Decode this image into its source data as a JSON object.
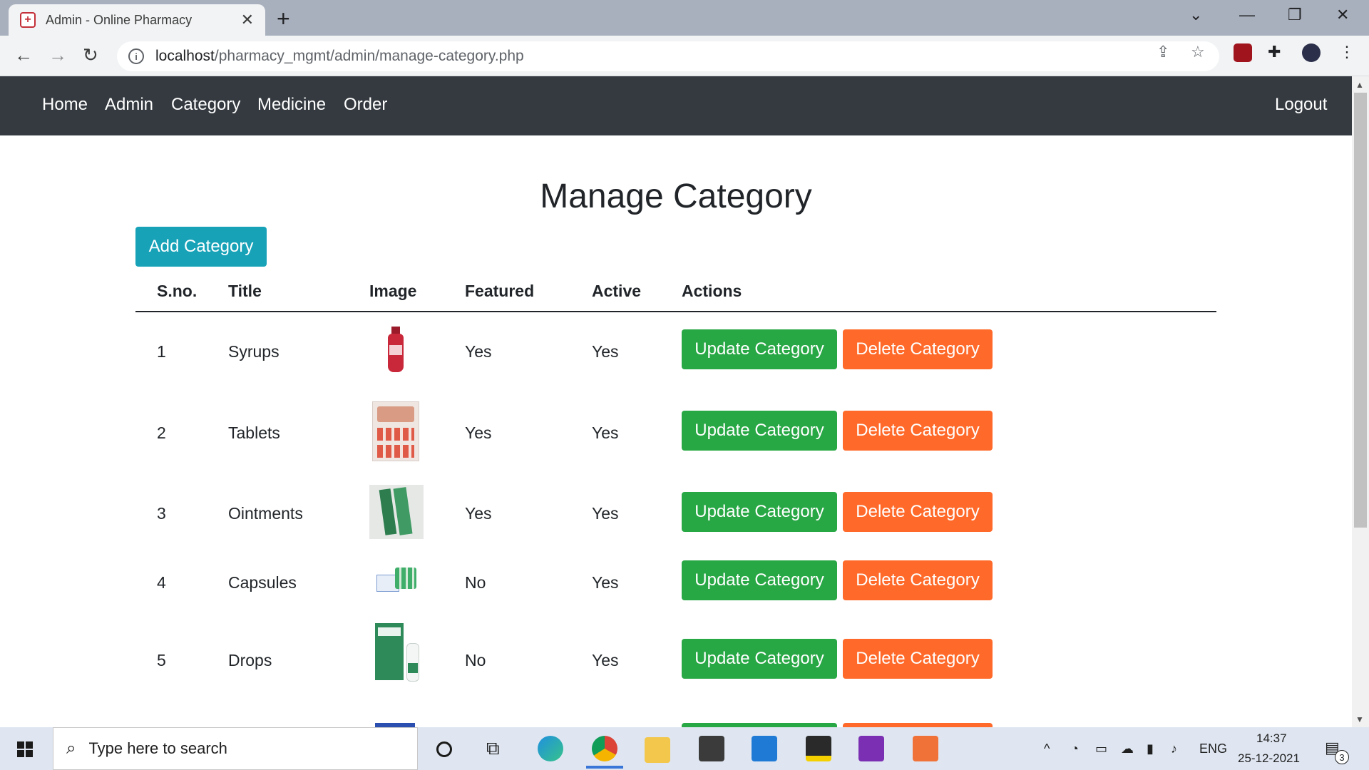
{
  "browser": {
    "tab_title": "Admin - Online Pharmacy",
    "url_host": "localhost",
    "url_path": "/pharmacy_mgmt/admin/manage-category.php"
  },
  "nav": {
    "links": [
      "Home",
      "Admin",
      "Category",
      "Medicine",
      "Order"
    ],
    "logout": "Logout"
  },
  "page": {
    "title": "Manage Category",
    "add_button": "Add Category"
  },
  "table": {
    "headers": [
      "S.no.",
      "Title",
      "Image",
      "Featured",
      "Active",
      "Actions"
    ],
    "rows": [
      {
        "sno": "1",
        "title": "Syrups",
        "featured": "Yes",
        "active": "Yes",
        "image_icon": "syrup-bottle-icon"
      },
      {
        "sno": "2",
        "title": "Tablets",
        "featured": "Yes",
        "active": "Yes",
        "image_icon": "tablets-strip-icon"
      },
      {
        "sno": "3",
        "title": "Ointments",
        "featured": "Yes",
        "active": "Yes",
        "image_icon": "ointment-tube-icon"
      },
      {
        "sno": "4",
        "title": "Capsules",
        "featured": "No",
        "active": "Yes",
        "image_icon": "capsules-pack-icon"
      },
      {
        "sno": "5",
        "title": "Drops",
        "featured": "No",
        "active": "Yes",
        "image_icon": "eye-drops-icon"
      }
    ],
    "update_label": "Update Category",
    "delete_label": "Delete Category"
  },
  "taskbar": {
    "search_placeholder": "Type here to search",
    "lang": "ENG",
    "time": "14:37",
    "date": "25-12-2021",
    "notifications": "3"
  },
  "colors": {
    "navbar": "#343a40",
    "add": "#17a2b8",
    "update": "#28a745",
    "delete": "#ff6a2a"
  }
}
